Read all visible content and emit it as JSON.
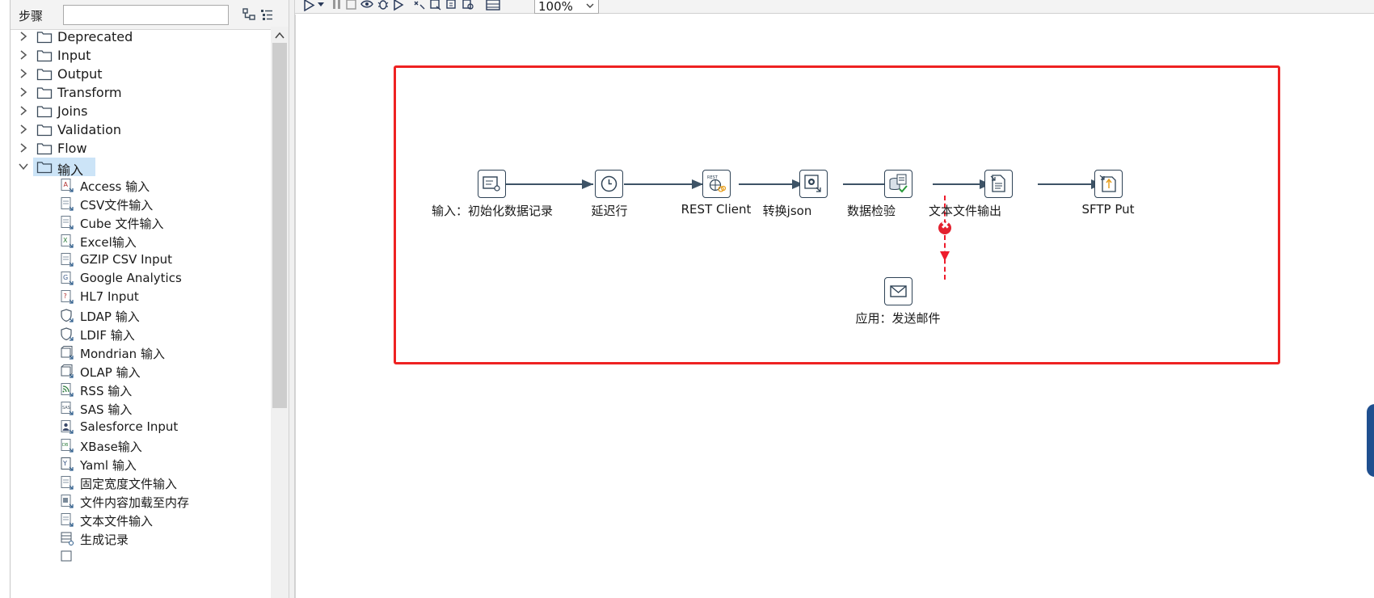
{
  "left_panel": {
    "title": "步骤",
    "search_value": "",
    "folders": [
      {
        "label": "Deprecated",
        "expanded": false
      },
      {
        "label": "Input",
        "expanded": false
      },
      {
        "label": "Output",
        "expanded": false
      },
      {
        "label": "Transform",
        "expanded": false
      },
      {
        "label": "Joins",
        "expanded": false
      },
      {
        "label": "Validation",
        "expanded": false
      },
      {
        "label": "Flow",
        "expanded": false
      },
      {
        "label": "输入",
        "expanded": true,
        "selected": true
      }
    ],
    "steps": [
      {
        "label": "Access 输入",
        "icon": "access-icon"
      },
      {
        "label": "CSV文件输入",
        "icon": "file-icon"
      },
      {
        "label": "Cube 文件输入",
        "icon": "file-icon"
      },
      {
        "label": "Excel输入",
        "icon": "excel-icon"
      },
      {
        "label": "GZIP CSV Input",
        "icon": "file-icon"
      },
      {
        "label": "Google Analytics",
        "icon": "google-analytics-icon"
      },
      {
        "label": "HL7 Input",
        "icon": "hl7-icon"
      },
      {
        "label": "LDAP 输入",
        "icon": "shield-icon"
      },
      {
        "label": "LDIF 输入",
        "icon": "shield-icon"
      },
      {
        "label": "Mondrian 输入",
        "icon": "cube-icon"
      },
      {
        "label": "OLAP 输入",
        "icon": "cube-icon"
      },
      {
        "label": "RSS 输入",
        "icon": "rss-icon"
      },
      {
        "label": "SAS 输入",
        "icon": "sas-icon"
      },
      {
        "label": "Salesforce Input",
        "icon": "salesforce-icon"
      },
      {
        "label": "XBase输入",
        "icon": "xbase-icon"
      },
      {
        "label": "Yaml 输入",
        "icon": "yaml-icon"
      },
      {
        "label": "固定宽度文件输入",
        "icon": "file-icon"
      },
      {
        "label": "文件内容加载至内存",
        "icon": "file-icon"
      },
      {
        "label": "文本文件输入",
        "icon": "file-icon"
      },
      {
        "label": "生成记录",
        "icon": "generate-rows-icon"
      }
    ]
  },
  "toolbar": {
    "zoom": "100%"
  },
  "canvas": {
    "nodes": [
      {
        "label": "输入：初始化数据记录",
        "icon": "table-input-icon"
      },
      {
        "label": "延迟行",
        "icon": "clock-icon"
      },
      {
        "label": "REST Client",
        "icon": "rest-globe-icon"
      },
      {
        "label": "转换json",
        "icon": "json-convert-icon"
      },
      {
        "label": "数据检验",
        "icon": "data-validator-icon"
      },
      {
        "label": "文本文件输出",
        "icon": "text-file-output-icon"
      },
      {
        "label": "SFTP Put",
        "icon": "sftp-put-icon"
      },
      {
        "label": "应用：发送邮件",
        "icon": "mail-icon"
      }
    ],
    "error_hop_from": "数据检验",
    "error_hop_to": "应用：发送邮件",
    "highlight_color": "#ee2222",
    "hop_color": "#3d5366",
    "error_color": "#ee1c2c"
  }
}
